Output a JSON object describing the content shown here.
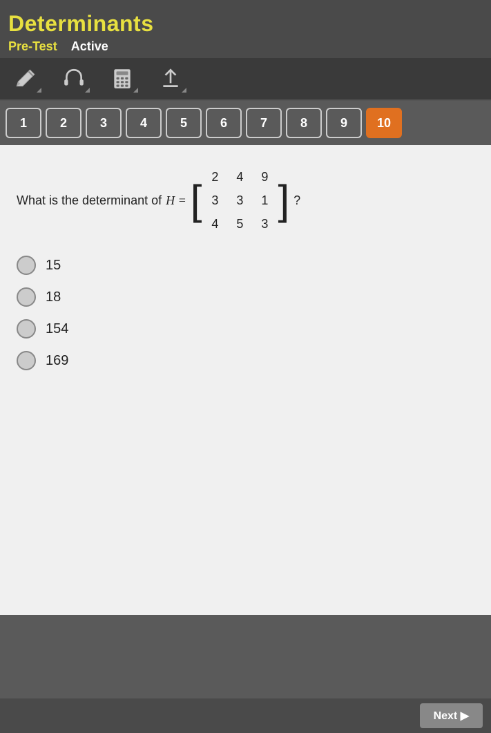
{
  "header": {
    "title": "Determinants",
    "pre_test_label": "Pre-Test",
    "active_label": "Active"
  },
  "toolbar": {
    "pencil_icon": "pencil",
    "headphone_icon": "headphone",
    "calculator_icon": "calculator",
    "upload_icon": "upload"
  },
  "tabs": {
    "items": [
      1,
      2,
      3,
      4,
      5,
      6,
      7,
      8,
      9,
      10
    ],
    "active": 10
  },
  "question": {
    "text_before": "What is the determinant of",
    "h_equals": "H =",
    "matrix": {
      "rows": [
        [
          2,
          4,
          9
        ],
        [
          3,
          3,
          1
        ],
        [
          4,
          5,
          3
        ]
      ]
    },
    "text_after": "?"
  },
  "options": [
    {
      "value": "15",
      "label": "15"
    },
    {
      "value": "18",
      "label": "18"
    },
    {
      "value": "154",
      "label": "154"
    },
    {
      "value": "169",
      "label": "169"
    }
  ],
  "bottom_bar": {
    "next_label": "Next ▶"
  }
}
